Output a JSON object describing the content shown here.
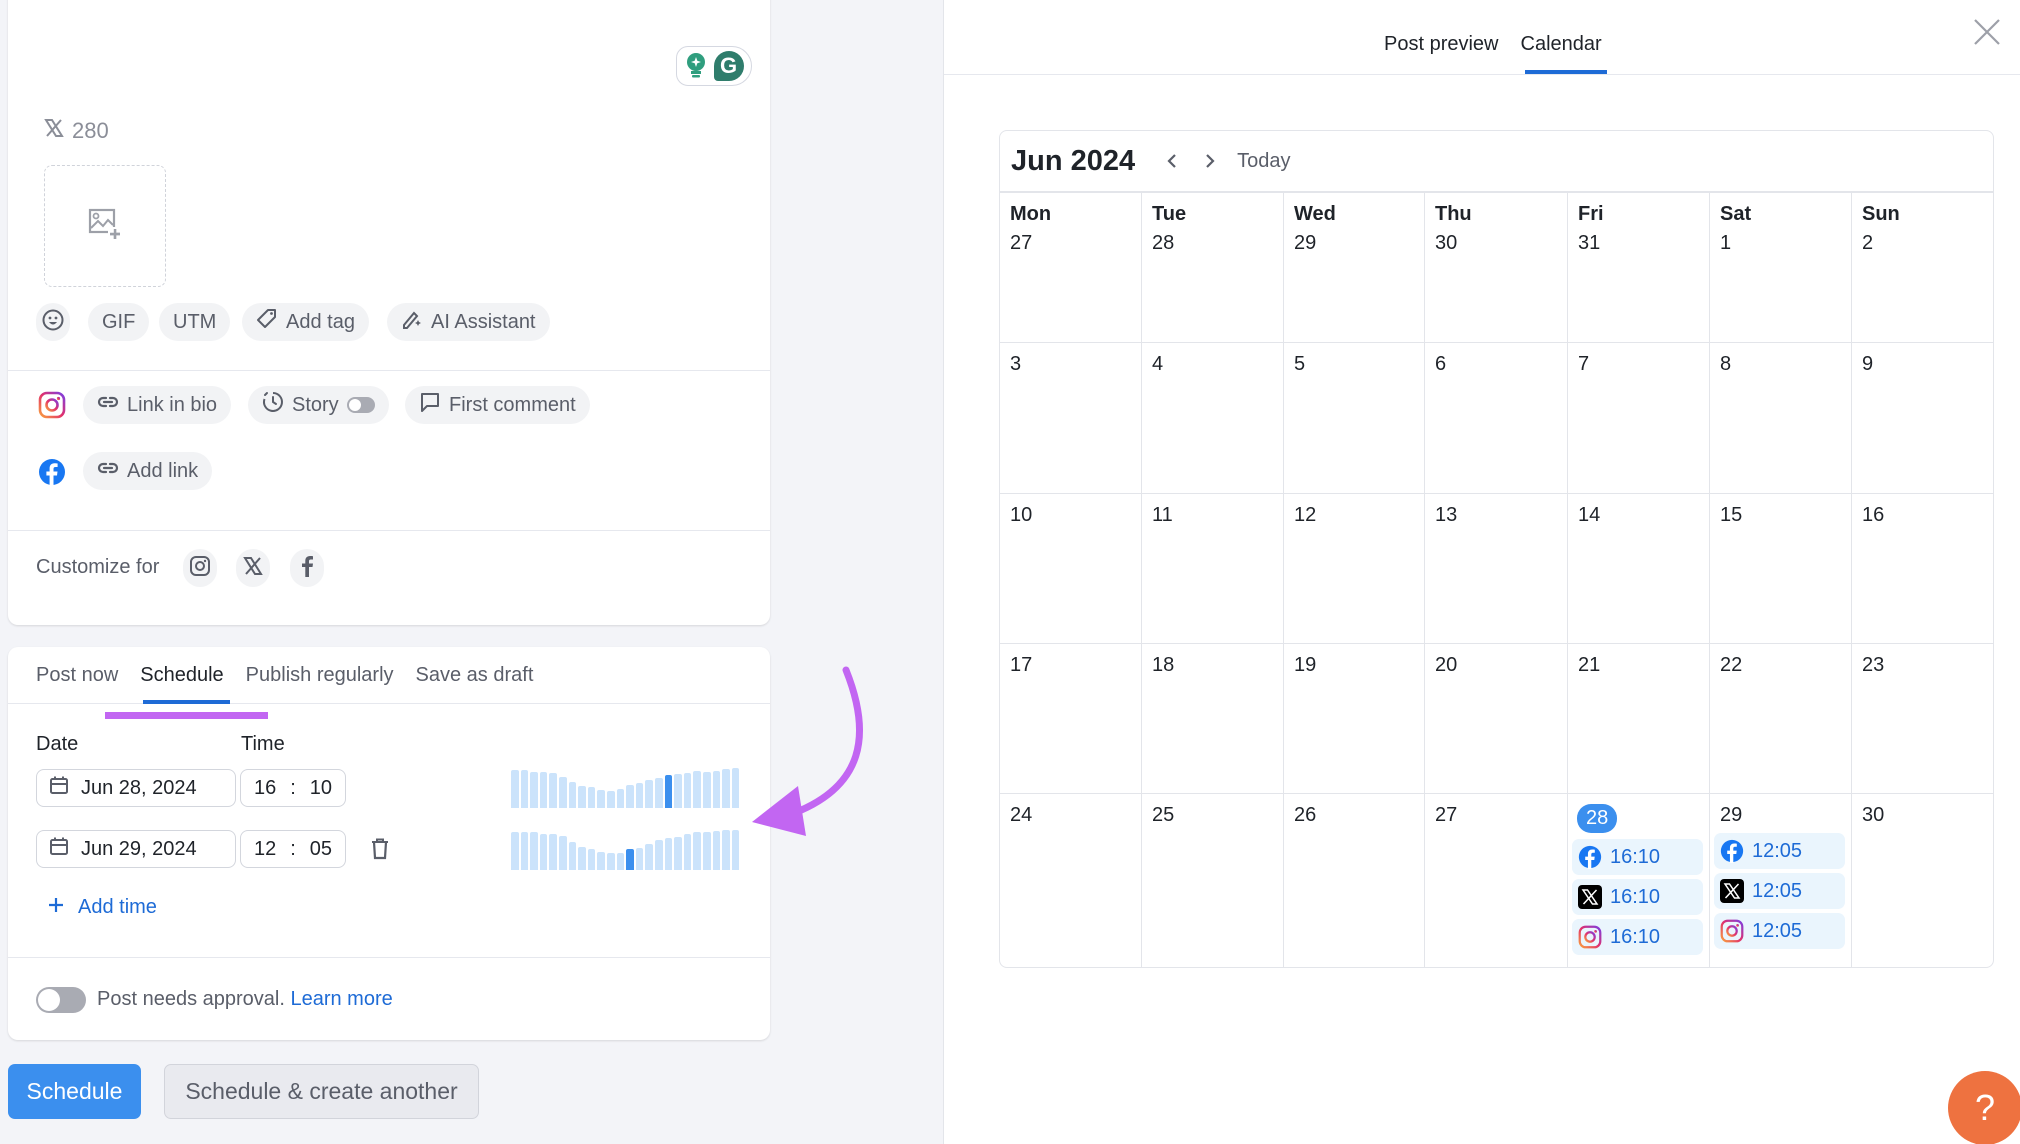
{
  "composer": {
    "char_counter": {
      "network": "x",
      "remaining": "280"
    },
    "toolbar": [
      {
        "id": "emoji",
        "label": "",
        "icon": "emoji-icon"
      },
      {
        "id": "gif",
        "label": "GIF"
      },
      {
        "id": "utm",
        "label": "UTM"
      },
      {
        "id": "tag",
        "label": "Add tag",
        "icon": "tag-icon"
      },
      {
        "id": "ai",
        "label": "AI Assistant",
        "icon": "ai-pen-icon"
      }
    ],
    "instagram_options": {
      "link_in_bio": "Link in bio",
      "story": "Story",
      "story_enabled": false,
      "first_comment": "First comment"
    },
    "facebook_options": {
      "add_link": "Add link"
    },
    "customize_for": {
      "label": "Customize for",
      "networks": [
        "instagram",
        "x",
        "facebook"
      ]
    }
  },
  "schedule_panel": {
    "tabs": [
      {
        "label": "Post now",
        "active": false
      },
      {
        "label": "Schedule",
        "active": true
      },
      {
        "label": "Publish regularly",
        "active": false
      },
      {
        "label": "Save as draft",
        "active": false
      }
    ],
    "date_label": "Date",
    "time_label": "Time",
    "slots": [
      {
        "date": "Jun 28, 2024",
        "hour": "16",
        "minute": "10",
        "deletable": false,
        "activity": [
          0.96,
          0.96,
          0.91,
          0.91,
          0.87,
          0.77,
          0.65,
          0.55,
          0.52,
          0.45,
          0.42,
          0.48,
          0.57,
          0.63,
          0.71,
          0.74,
          0.83,
          0.84,
          0.87,
          0.93,
          0.91,
          0.93,
          0.97,
          1.0
        ],
        "highlight_hour": 16
      },
      {
        "date": "Jun 29, 2024",
        "hour": "12",
        "minute": "05",
        "deletable": true,
        "activity": [
          0.96,
          0.94,
          0.94,
          0.91,
          0.89,
          0.84,
          0.71,
          0.58,
          0.52,
          0.46,
          0.42,
          0.43,
          0.52,
          0.54,
          0.65,
          0.74,
          0.8,
          0.83,
          0.9,
          0.96,
          0.96,
          0.97,
          1.0,
          1.0
        ],
        "highlight_hour": 12
      }
    ],
    "add_time": "Add time",
    "approval": {
      "text": "Post needs approval.",
      "link": "Learn more",
      "enabled": false
    }
  },
  "actions": {
    "primary": "Schedule",
    "secondary": "Schedule & create another"
  },
  "right_panel": {
    "tabs": [
      {
        "label": "Post preview",
        "active": false
      },
      {
        "label": "Calendar",
        "active": true
      }
    ],
    "calendar": {
      "title": "Jun 2024",
      "today_label": "Today",
      "weekdays": [
        "Mon",
        "Tue",
        "Wed",
        "Thu",
        "Fri",
        "Sat",
        "Sun"
      ],
      "weeks": [
        [
          "27",
          "28",
          "29",
          "30",
          "31",
          "1",
          "2"
        ],
        [
          "3",
          "4",
          "5",
          "6",
          "7",
          "8",
          "9"
        ],
        [
          "10",
          "11",
          "12",
          "13",
          "14",
          "15",
          "16"
        ],
        [
          "17",
          "18",
          "19",
          "20",
          "21",
          "22",
          "23"
        ],
        [
          "24",
          "25",
          "26",
          "27",
          "28",
          "29",
          "30"
        ]
      ],
      "selected_day": {
        "week": 4,
        "col": 4
      },
      "events": [
        {
          "week": 4,
          "col": 4,
          "items": [
            {
              "network": "facebook",
              "time": "16:10"
            },
            {
              "network": "x",
              "time": "16:10"
            },
            {
              "network": "instagram",
              "time": "16:10"
            }
          ]
        },
        {
          "week": 4,
          "col": 5,
          "items": [
            {
              "network": "facebook",
              "time": "12:05"
            },
            {
              "network": "x",
              "time": "12:05"
            },
            {
              "network": "instagram",
              "time": "12:05"
            }
          ]
        }
      ]
    }
  },
  "help_button": "?",
  "colors": {
    "accent": "#3b8fee",
    "link": "#1e6bd6",
    "annotation": "#c266f2",
    "help": "#ee7240",
    "bar_light": "#cbe3fb"
  }
}
